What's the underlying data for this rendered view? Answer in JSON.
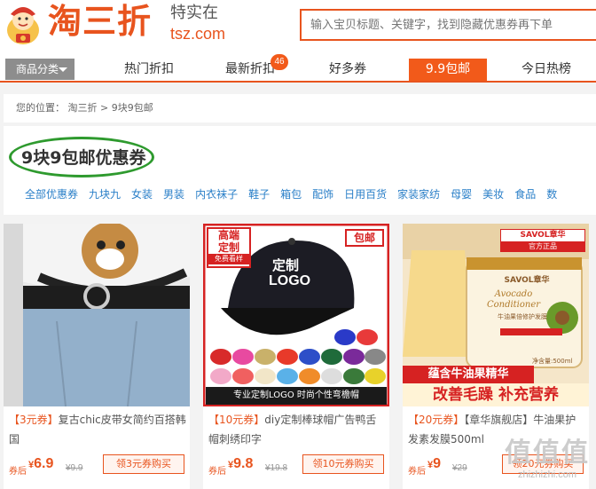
{
  "header": {
    "brand": "淘三折",
    "slogan": "特实在",
    "domain": "tsz.com",
    "search_placeholder": "输入宝贝标题、关键字，找到隐藏优惠券再下单"
  },
  "nav": {
    "category_button": "商品分类",
    "items": [
      {
        "label": "热门折扣"
      },
      {
        "label": "最新折扣",
        "badge": "46"
      },
      {
        "label": "好多券"
      },
      {
        "label": "9.9包邮",
        "active": true
      },
      {
        "label": "今日热榜"
      }
    ]
  },
  "breadcrumb": {
    "prefix": "您的位置：",
    "home": "淘三折",
    "sep": ">",
    "current": "9块9包邮"
  },
  "page": {
    "title": "9块9包邮优惠券",
    "filters": [
      "全部优惠券",
      "九块九",
      "女装",
      "男装",
      "内衣袜子",
      "鞋子",
      "箱包",
      "配饰",
      "日用百货",
      "家装家纺",
      "母婴",
      "美妆",
      "食品",
      "数"
    ]
  },
  "products": [
    {
      "tag": "【3元券】",
      "title": "复古chic皮带女简约百搭韩国",
      "price_label": "券后",
      "yen": "¥",
      "price": "6.9",
      "original": "¥9.9",
      "button": "领3元券购买"
    },
    {
      "tag": "【10元券】",
      "title": "diy定制棒球帽广告鸭舌帽刺绣印字",
      "price_label": "券后",
      "yen": "¥",
      "price": "9.8",
      "original": "¥19.8",
      "button": "领10元券购买",
      "image_text": {
        "corner_top": "高端",
        "corner_mid": "定制",
        "corner_sub": "免费看样",
        "badge": "包邮",
        "custom": "定制",
        "logo": "LOGO",
        "bottom": "专业定制LOGO 时尚个性弯檐帽"
      }
    },
    {
      "tag": "【20元券】",
      "title": "【章华旗舰店】牛油果护发素发膜500ml",
      "price_label": "券后",
      "yen": "¥",
      "price": "9",
      "original": "¥29",
      "button": "领20元券购买",
      "image_text": {
        "brand": "SAVOL章华",
        "official": "官方正品",
        "line1": "蕴含牛油果精华",
        "line2": "改善毛躁 补充营养",
        "jar_brand": "SAVOL章华",
        "jar_title": "Avocado Conditioner",
        "jar_name": "牛油果倍修护发膜",
        "jar_net": "净含量:500ml"
      }
    }
  ],
  "watermark": {
    "big": "值值值",
    "small": "zhizhizhi.com"
  },
  "colors": {
    "brand_orange": "#e8541e",
    "link_blue": "#2a7fc8",
    "title_ring_green": "#2e9a2e"
  }
}
